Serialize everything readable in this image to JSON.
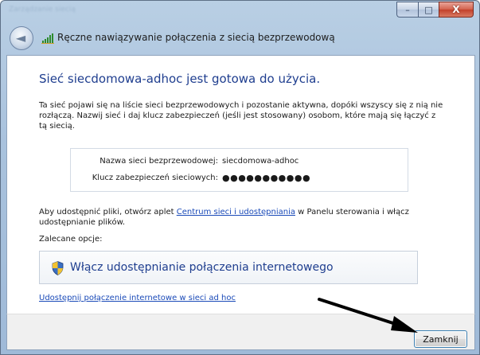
{
  "window": {
    "blurred_title": "Zarządzanie siecią",
    "minimize_glyph": "–",
    "maximize_glyph": "□",
    "close_glyph": "X"
  },
  "nav": {
    "back_glyph": "◄",
    "icon": "network-signal-icon",
    "title": "Ręczne nawiązywanie połączenia z siecią bezprzewodową"
  },
  "content": {
    "heading": "Sieć siecdomowa-adhoc jest gotowa do użycia.",
    "description": "Ta sieć pojawi się na liście sieci bezprzewodowych i pozostanie aktywna, dopóki wszyscy się z nią nie rozłączą. Nazwij sieć i daj klucz zabezpieczeń (jeśli jest stosowany) osobom, które mają się łączyć z tą siecią.",
    "info": {
      "network_name_label": "Nazwa sieci bezprzewodowej:",
      "network_name_value": "siecdomowa-adhoc",
      "security_key_label": "Klucz zabezpieczeń sieciowych:",
      "security_key_value": "●●●●●●●●●●●"
    },
    "share_text_before": "Aby udostępnić pliki, otwórz aplet ",
    "share_link": "Centrum sieci i udostępniania",
    "share_text_after": " w Panelu sterowania i włącz udostępnianie plików.",
    "recommended_label": "Zalecane opcje:",
    "option_label": "Włącz udostępnianie połączenia internetowego",
    "option_icon": "shield-icon",
    "adhoc_link": "Udostępnij połączenie internetowe w sieci ad hoc"
  },
  "footer": {
    "close_button": "Zamknij"
  },
  "colors": {
    "heading": "#1f3e8f",
    "link": "#1a4ab8",
    "arrow": "#000000"
  }
}
